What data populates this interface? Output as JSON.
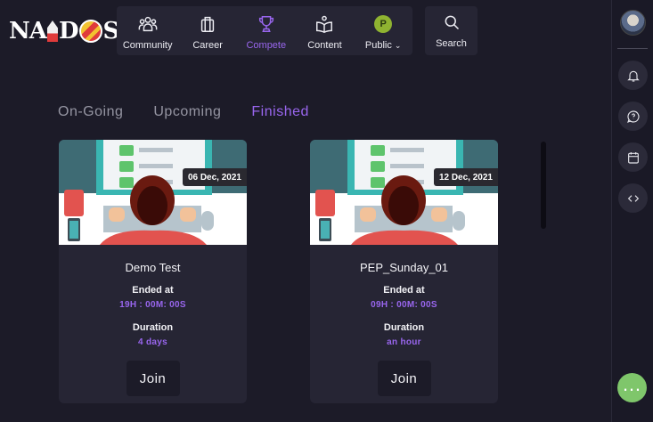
{
  "logo": {
    "text_left": "NA",
    "text_mid": "D",
    "text_right": "S"
  },
  "nav": {
    "items": [
      {
        "label": "Community",
        "icon": "community-icon"
      },
      {
        "label": "Career",
        "icon": "briefcase-icon"
      },
      {
        "label": "Compete",
        "icon": "trophy-icon"
      },
      {
        "label": "Content",
        "icon": "book-icon"
      },
      {
        "label": "Public",
        "icon": "avatar-p"
      }
    ],
    "public_avatar": "P",
    "search_label": "Search"
  },
  "tabs": [
    {
      "label": "On-Going"
    },
    {
      "label": "Upcoming"
    },
    {
      "label": "Finished"
    }
  ],
  "colors": {
    "accent": "#9966ee",
    "bg": "#1c1b28",
    "card": "#262534",
    "chat": "#7fc66b"
  },
  "cards": [
    {
      "date": "06 Dec, 2021",
      "title": "Demo Test",
      "ended_label": "Ended at",
      "ended_value": "19H : 00M: 00S",
      "duration_label": "Duration",
      "duration_value": "4 days",
      "join_label": "Join"
    },
    {
      "date": "12 Dec, 2021",
      "title": "PEP_Sunday_01",
      "ended_label": "Ended at",
      "ended_value": "09H : 00M: 00S",
      "duration_label": "Duration",
      "duration_value": "an hour",
      "join_label": "Join"
    }
  ],
  "rail": {
    "buttons": [
      "bell-icon",
      "chat-help-icon",
      "calendar-icon",
      "code-icon"
    ]
  }
}
